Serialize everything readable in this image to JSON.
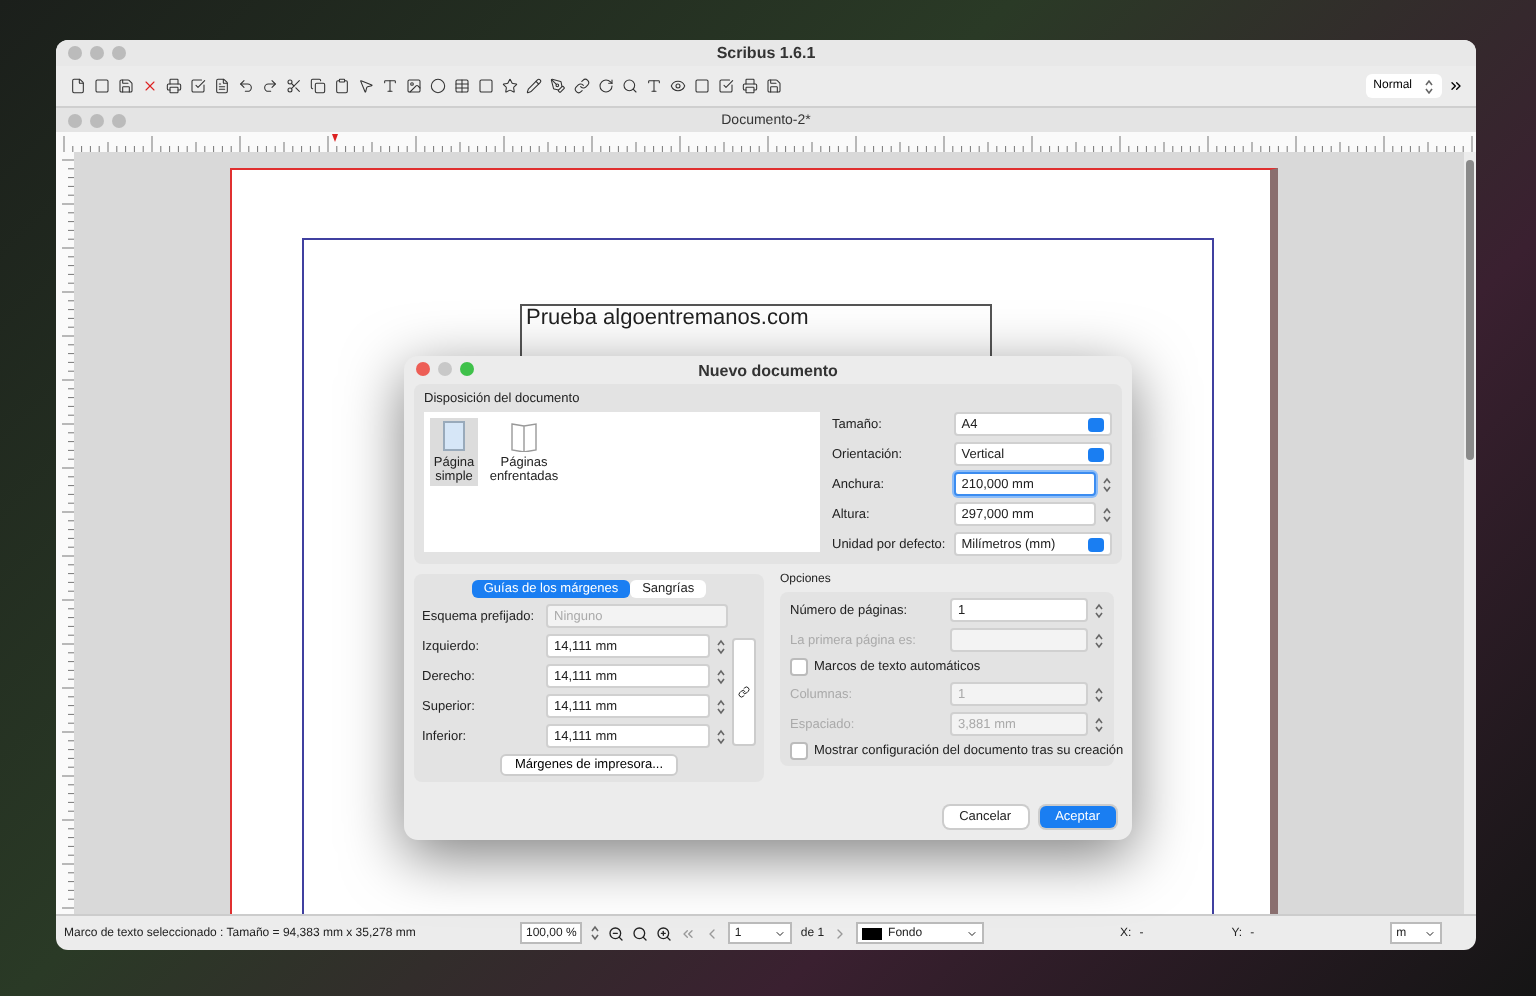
{
  "window": {
    "title": "Scribus 1.6.1"
  },
  "toolbar": {
    "style_select": "Normal"
  },
  "document": {
    "title": "Documento-2*",
    "text_frame": "Prueba algoentremanos.com"
  },
  "dialog": {
    "title": "Nuevo documento",
    "layout_section": "Disposición del documento",
    "page_types": [
      {
        "label": "Página simple",
        "selected": true,
        "kind": "single"
      },
      {
        "label": "Páginas enfrentadas",
        "selected": false,
        "kind": "facing"
      }
    ],
    "page_fields": [
      {
        "label": "Tamaño:",
        "value": "A4",
        "kind": "select",
        "focused": false
      },
      {
        "label": "Orientación:",
        "value": "Vertical",
        "kind": "select",
        "focused": false
      },
      {
        "label": "Anchura:",
        "value": "210,000 mm",
        "kind": "spin",
        "focused": true
      },
      {
        "label": "Altura:",
        "value": "297,000 mm",
        "kind": "spin",
        "focused": false
      },
      {
        "label": "Unidad por defecto:",
        "value": "Milímetros (mm)",
        "kind": "select",
        "focused": false
      }
    ],
    "tabs": [
      {
        "label": "Guías de los márgenes",
        "selected": true
      },
      {
        "label": "Sangrías",
        "selected": false
      }
    ],
    "preset": {
      "label": "Esquema prefijado:",
      "value": "Ninguno",
      "disabled": true
    },
    "margins": [
      {
        "label": "Izquierdo:",
        "value": "14,111 mm"
      },
      {
        "label": "Derecho:",
        "value": "14,111 mm"
      },
      {
        "label": "Superior:",
        "value": "14,111 mm"
      },
      {
        "label": "Inferior:",
        "value": "14,111 mm"
      }
    ],
    "printer_margins_button": "Márgenes de impresora...",
    "options_title": "Opciones",
    "options": [
      {
        "kind": "spin",
        "label": "Número de páginas:",
        "value": "1",
        "disabled": false
      },
      {
        "kind": "select",
        "label": "La primera página es:",
        "disabled": true
      },
      {
        "kind": "checkbox",
        "label": "Marcos de texto automáticos",
        "checked": false
      },
      {
        "kind": "spin",
        "label": "Columnas:",
        "value": "1",
        "disabled": true
      },
      {
        "kind": "spin",
        "label": "Espaciado:",
        "value": "3,881 mm",
        "disabled": true
      },
      {
        "kind": "checkbox",
        "label": "Mostrar configuración del documento tras su creación",
        "checked": false
      }
    ],
    "buttons": [
      {
        "label": "Cancelar",
        "primary": false
      },
      {
        "label": "Aceptar",
        "primary": true
      }
    ]
  },
  "status_bar": {
    "message": "Marco de texto seleccionado : Tamaño = 94,383 mm x 35,278 mm",
    "zoom": "100,00 %",
    "page": "1",
    "page_of": "de 1",
    "layer": "Fondo",
    "x_label": "X:",
    "x_value": "-",
    "y_label": "Y:",
    "y_value": "-",
    "unit": "m"
  }
}
